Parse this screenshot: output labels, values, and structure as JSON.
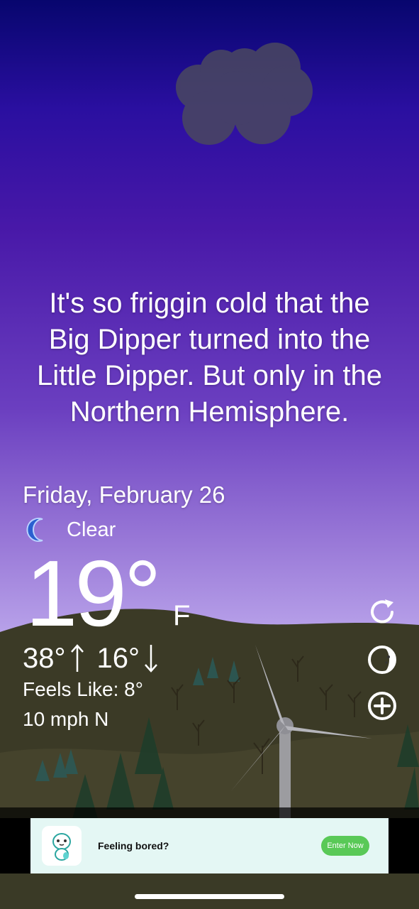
{
  "quote": {
    "lines": [
      "It's so friggin cold that the",
      "Big Dipper turned into the",
      "Little Dipper. But only in the",
      "Northern Hemisphere."
    ]
  },
  "date": "Friday, February 26",
  "condition": {
    "label": "Clear",
    "icon": "crescent-moon-icon"
  },
  "temperature": {
    "value": "19°",
    "unit": "F"
  },
  "high_low": {
    "high": "38°",
    "low": "16°"
  },
  "feels_like": "Feels Like: 8°",
  "wind": "10 mph N",
  "controls": [
    "refresh-icon",
    "moon-phase-icon",
    "add-icon"
  ],
  "ad": {
    "text": "Feeling bored?",
    "button": "Enter Now"
  },
  "colors": {
    "sky_top": "#07066e",
    "sky_mid": "#6b3fc0",
    "sky_low": "#c7b3f2",
    "hills": "#3b3a26",
    "ad_bg": "#e4f7f4",
    "ad_button": "#59c957"
  }
}
